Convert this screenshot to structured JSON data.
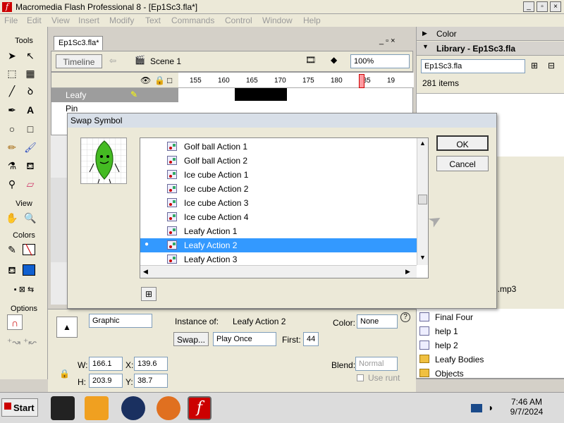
{
  "window": {
    "title": "Macromedia Flash Professional 8 - [Ep1Sc3.fla*]",
    "minimize": "_",
    "restore": "▫",
    "close": "×"
  },
  "menu": [
    "File",
    "Edit",
    "View",
    "Insert",
    "Modify",
    "Text",
    "Commands",
    "Control",
    "Window",
    "Help"
  ],
  "tools": {
    "title": "Tools",
    "view_label": "View",
    "colors_label": "Colors",
    "options_label": "Options"
  },
  "document": {
    "tab": "Ep1Sc3.fla*",
    "timeline_button": "Timeline",
    "scene": "Scene 1",
    "zoom": "100%",
    "frame_numbers": [
      "155",
      "160",
      "165",
      "170",
      "175",
      "180",
      "185",
      "19"
    ],
    "layers": [
      "Leafy",
      "Pin"
    ]
  },
  "right_panel": {
    "color_title": "Color",
    "library_title": "Library - Ep1Sc3.fla",
    "library_select": "Ep1Sc3.fla",
    "items_count": "281 items",
    "partial_item": "3.mp3",
    "items": [
      {
        "name": "Final Four",
        "type": "symbol"
      },
      {
        "name": "help 1",
        "type": "symbol"
      },
      {
        "name": "help 2",
        "type": "symbol"
      },
      {
        "name": "Leafy Bodies",
        "type": "folder"
      },
      {
        "name": "Objects",
        "type": "folder"
      }
    ]
  },
  "properties": {
    "type": "Graphic",
    "instance_of_label": "Instance of:",
    "instance_of_value": "Leafy Action 2",
    "color_label": "Color:",
    "color_value": "None",
    "swap_button": "Swap...",
    "loop": "Play Once",
    "first_label": "First:",
    "first_value": "44",
    "blend_label": "Blend:",
    "blend_value": "Normal",
    "use_runtime": "Use runt",
    "w_label": "W:",
    "w_value": "166.1",
    "x_label": "X:",
    "x_value": "139.6",
    "h_label": "H:",
    "h_value": "203.9",
    "y_label": "Y:",
    "y_value": "38.7",
    "help": "?"
  },
  "dialog": {
    "title": "Swap Symbol",
    "ok": "OK",
    "cancel": "Cancel",
    "items": [
      {
        "label": "Golf ball Action 1",
        "selected": false
      },
      {
        "label": "Golf ball Action 2",
        "selected": false
      },
      {
        "label": "Ice cube Action 1",
        "selected": false
      },
      {
        "label": "Ice cube Action 2",
        "selected": false
      },
      {
        "label": "Ice cube Action 3",
        "selected": false
      },
      {
        "label": "Ice cube Action 4",
        "selected": false
      },
      {
        "label": "Leafy Action 1",
        "selected": false
      },
      {
        "label": "Leafy Action 2",
        "selected": true
      },
      {
        "label": "Leafy Action 3",
        "selected": false
      }
    ],
    "selected_bullet": "●"
  },
  "taskbar": {
    "start": "Start",
    "time": "7:46 AM",
    "date": "9/7/2024"
  },
  "colors": {
    "selection": "#3399ff",
    "leafy_green": "#44bb22",
    "flash_red": "#cc0000"
  }
}
